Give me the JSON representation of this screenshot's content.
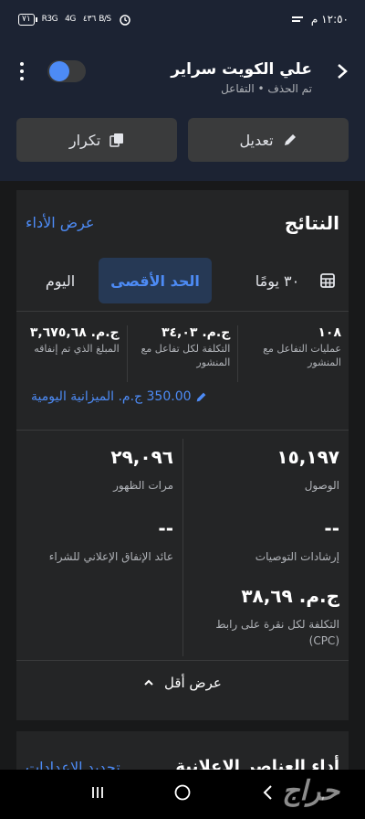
{
  "status_bar": {
    "time": "١٢:٥٠ م",
    "battery": "٧١",
    "signal": "R3G",
    "signal2": "4G",
    "net_speed": "٤٣٦ B/S"
  },
  "header": {
    "title": "علي الكويت سراير",
    "subtitle": "تم الحذف • التفاعل"
  },
  "actions": {
    "edit_label": "تعديل",
    "duplicate_label": "تكرار"
  },
  "results": {
    "title": "النتائج",
    "view_performance": "عرض الأداء",
    "tabs": {
      "days30": "٣٠ يومًا",
      "maximum": "الحد الأقصى",
      "today": "اليوم"
    },
    "summary": [
      {
        "value": "١٠٨",
        "label": "عمليات التفاعل مع المنشور"
      },
      {
        "value": "ج.م. ٣٤,٠٣",
        "label": "التكلفة لكل تفاعل مع المنشور"
      },
      {
        "value": "ج.م. ٣,٦٧٥,٦٨",
        "label": "المبلغ الذي تم إنفاقه"
      }
    ],
    "daily_budget": "350.00 ج.م. الميزانية اليومية",
    "metrics": {
      "reach": {
        "value": "١٥,١٩٧",
        "label": "الوصول"
      },
      "impressions": {
        "value": "٢٩,٠٩٦",
        "label": "مرات الظهور"
      },
      "recommendations": {
        "value": "--",
        "label": "إرشادات التوصيات"
      },
      "roas": {
        "value": "--",
        "label": "عائد الإنفاق الإعلاني للشراء"
      },
      "cpc": {
        "value": "ج.م. ٣٨,٦٩",
        "label": "التكلفة لكل نقرة على رابط (CPC)"
      }
    },
    "show_less": "عرض أقل"
  },
  "next_section": {
    "title": "أداء العناصر الإعلانية",
    "link": "تحديد الإعدادات"
  },
  "watermark": "حراج",
  "colors": {
    "accent": "#4d8bf5",
    "background": "#18191a",
    "card": "#242526",
    "header": "#1c2333"
  }
}
